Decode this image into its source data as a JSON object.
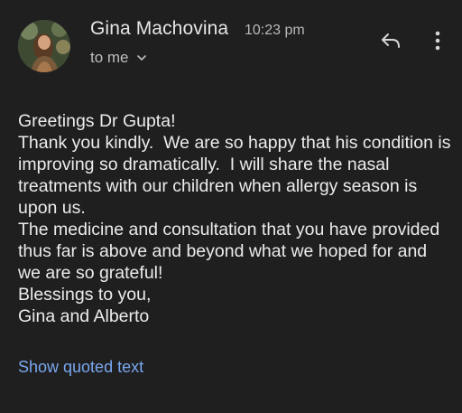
{
  "header": {
    "sender_name": "Gina Machovina",
    "time": "10:23 pm",
    "recipient": "to me",
    "avatar_icon": "avatar-photo",
    "reply_icon": "reply-icon",
    "more_icon": "more-vert-icon"
  },
  "message": {
    "lines": [
      "Greetings Dr Gupta!",
      "Thank you kindly.  We are so happy that his condition is improving so dramatically.  I will share the nasal treatments with our children when allergy season is upon us.",
      "The medicine and consultation that you have provided thus far is above and beyond what we hoped for and we are so grateful!",
      "Blessings to you,",
      "Gina and Alberto"
    ]
  },
  "footer": {
    "show_quoted_label": "Show quoted text"
  },
  "colors": {
    "background": "#1f1f1f",
    "text": "#ececec",
    "secondary_text": "#bdbdbd",
    "link": "#7aa7f0"
  }
}
